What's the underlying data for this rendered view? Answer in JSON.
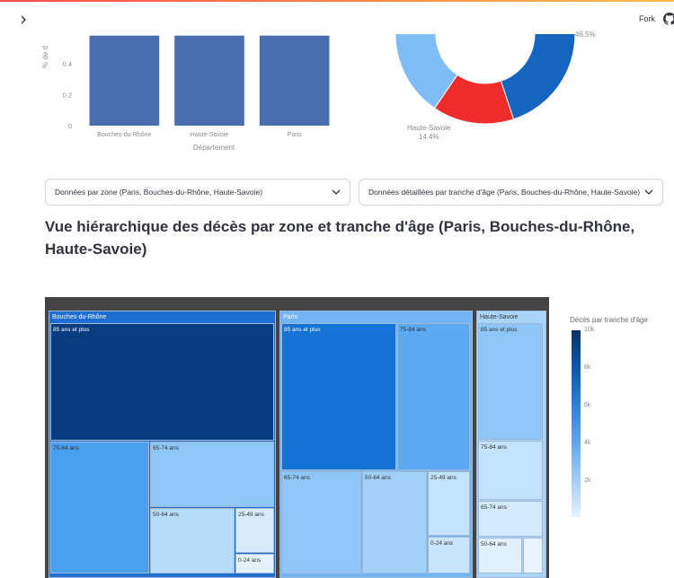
{
  "header": {
    "fork_label": "Fork",
    "sidebar_icon": "chevron-right-icon",
    "github_icon": "github-icon"
  },
  "bar_chart": {
    "ylabel_fragment": "% de d",
    "xlabel": "Département",
    "yticks": [
      "0",
      "0.2",
      "0.4"
    ],
    "bar_color": "#4a6fb0"
  },
  "pie": {
    "top_right_label": "46.5%",
    "haute_savoie_label": "Haute-Savoie",
    "haute_savoie_pct": "14.4%",
    "colors": [
      "#1565c0",
      "#ef2b2b",
      "#80bdf7"
    ]
  },
  "chart_data": [
    {
      "type": "bar",
      "categories": [
        "Bouches-du-Rhône",
        "Haute-Savoie",
        "Paris"
      ],
      "values": [
        0.58,
        0.58,
        0.58
      ],
      "xlabel": "Département",
      "ylabel": "% de d",
      "ylim": [
        0,
        0.6
      ]
    },
    {
      "type": "pie",
      "categories": [
        "Paris",
        "Bouches-du-Rhône",
        "Haute-Savoie"
      ],
      "values": [
        46.5,
        20.7,
        14.4
      ],
      "labels": [
        "46.5%",
        "",
        "14.4%"
      ]
    },
    {
      "type": "heatmap",
      "title": "",
      "colorbar_title": "Décès par tranche d'âge",
      "colorbar_ticks": [
        "10k",
        "8k",
        "6k",
        "4k",
        "2k"
      ],
      "zones": [
        {
          "name": "Bouches-du-Rhône",
          "groups": [
            "85 ans et plus",
            "75-84 ans",
            "65-74 ans",
            "50-64 ans",
            "25-49 ans",
            "0-24 ans"
          ]
        },
        {
          "name": "Paris",
          "groups": [
            "85 ans et plus",
            "75-84 ans",
            "65-74 ans",
            "50-64 ans",
            "25-49 ans",
            "0-24 ans"
          ]
        },
        {
          "name": "Haute-Savoie",
          "groups": [
            "85 ans et plus",
            "75-84 ans",
            "65-74 ans",
            "50-64 ans"
          ]
        }
      ]
    }
  ],
  "selects": {
    "zone": "Données par zone (Paris, Bouches-du-Rhône, Haute-Savoie)",
    "age": "Données détaillées par tranche d'âge (Paris, Bouches-du-Rhône, Haute-Savoie)"
  },
  "section_title": "Vue hiérarchique des décès par zone et tranche d'âge (Paris, Bouches-du-Rhône, Haute-Savoie)",
  "treemap": {
    "zones": {
      "bdr": "Bouches-du-Rhône",
      "paris": "Paris",
      "hs": "Haute-Savoie"
    },
    "tiles": {
      "t85": "85 ans et plus",
      "t75": "75-84 ans",
      "t65": "65-74 ans",
      "t50": "50-64 ans",
      "t25": "25-49 ans",
      "t0": "0-24 ans"
    },
    "colorbar_title": "Décès par tranche d'âge",
    "colorbar_ticks": [
      "10k",
      "8k",
      "6k",
      "4k",
      "2k"
    ]
  }
}
